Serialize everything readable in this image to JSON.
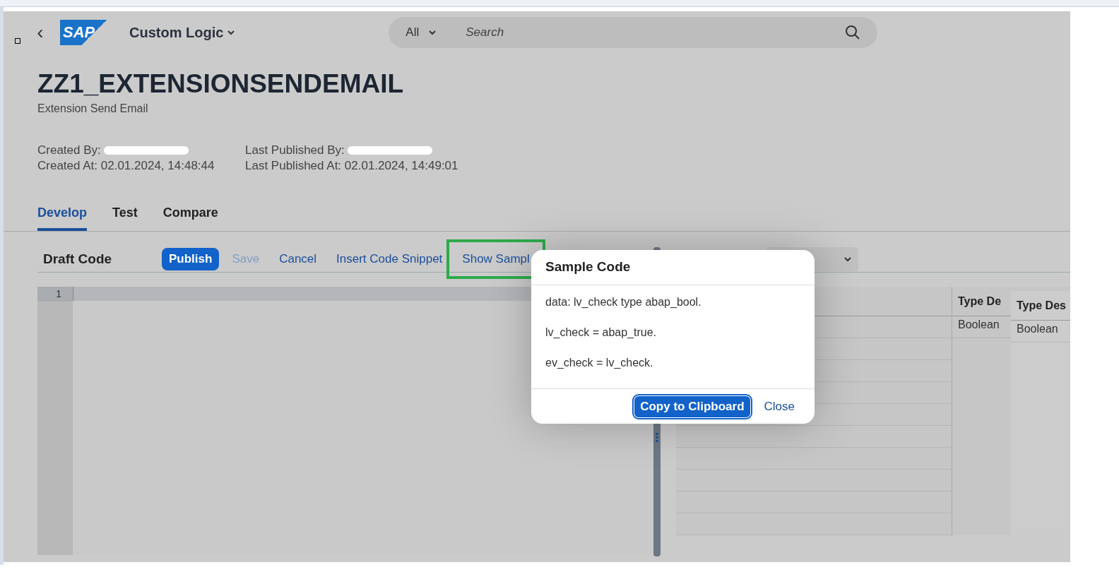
{
  "shell": {
    "back": "‹",
    "logo": "SAP",
    "app_title": "Custom Logic",
    "search_scope": "All",
    "search_placeholder": "Search"
  },
  "header": {
    "title": "ZZ1_EXTENSIONSENDEMAIL",
    "subtitle": "Extension Send Email",
    "attributes": [
      {
        "label": "Created By:",
        "redacted": true
      },
      {
        "label": "Last Published By:",
        "redacted": true
      },
      {
        "label": "Created At: 02.01.2024, 14:48:44",
        "redacted": false
      },
      {
        "label": "Last Published At: 02.01.2024, 14:49:01",
        "redacted": false
      }
    ]
  },
  "tabs": [
    {
      "label": "Develop",
      "selected": true
    },
    {
      "label": "Test",
      "selected": false
    },
    {
      "label": "Compare",
      "selected": false
    }
  ],
  "toolbar": {
    "title": "Draft Code",
    "actions": [
      {
        "label": "Publish",
        "kind": "emphasized",
        "disabled": false
      },
      {
        "label": "Save",
        "kind": "transparent",
        "disabled": true
      },
      {
        "label": "Cancel",
        "kind": "transparent",
        "disabled": false
      },
      {
        "label": "Insert Code Snippet",
        "kind": "transparent",
        "disabled": false
      },
      {
        "label": "Show Sampl",
        "kind": "transparent",
        "disabled": false,
        "highlighted": true
      }
    ]
  },
  "editor": {
    "line_numbers": [
      "1"
    ]
  },
  "parameters_table": {
    "columns": [
      "Type De",
      "Type Des"
    ],
    "rows": [
      [
        "Boolean",
        "Boolean"
      ]
    ]
  },
  "dialog": {
    "title": "Sample Code",
    "lines": [
      "data: lv_check type abap_bool.",
      "lv_check = abap_true.",
      "ev_check = lv_check."
    ],
    "buttons": [
      {
        "label": "Copy to Clipboard",
        "kind": "emphasized"
      },
      {
        "label": "Close",
        "kind": "transparent"
      }
    ]
  }
}
